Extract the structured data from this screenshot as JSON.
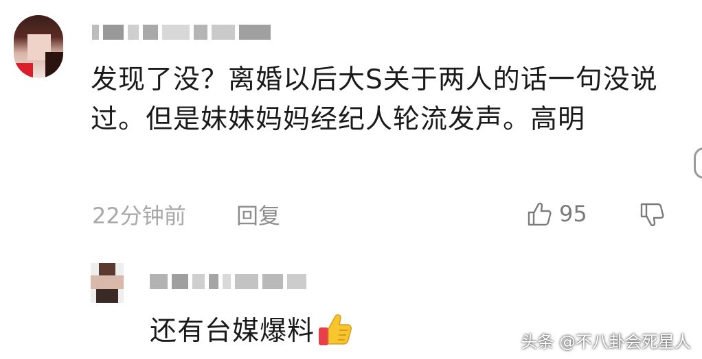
{
  "comment": {
    "text": "发现了没？离婚以后大S关于两人的话一句没说过。但是妹妹妈妈经纪人轮流发声。高明",
    "time": "22分钟前",
    "reply_label": "回复",
    "like_count": "95",
    "icons": {
      "like": "thumbs-up-icon",
      "dislike": "thumbs-down-icon"
    }
  },
  "reply": {
    "text": "还有台媒爆料",
    "emoji": "thumbs-up-emoji"
  },
  "watermark": "头条 @不八卦会死星人"
}
